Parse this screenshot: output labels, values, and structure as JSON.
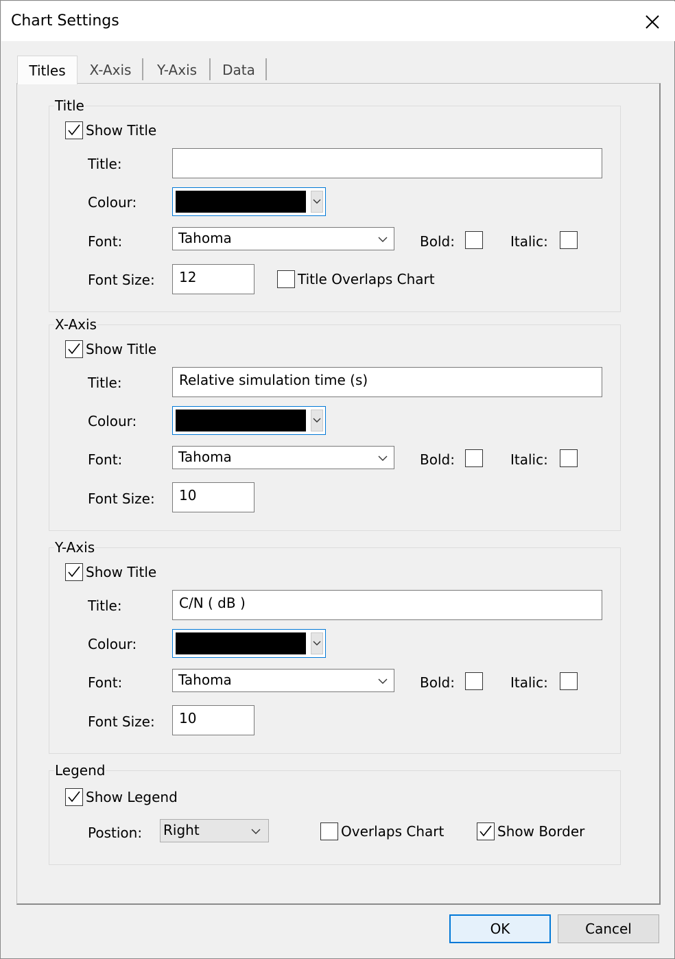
{
  "window": {
    "title": "Chart Settings"
  },
  "tabs": [
    "Titles",
    "X-Axis",
    "Y-Axis",
    "Data"
  ],
  "title_group": {
    "label": "Title",
    "show_title_label": "Show Title",
    "show_title_checked": true,
    "title_label": "Title:",
    "title_value": "",
    "colour_label": "Colour:",
    "colour_value": "#000000",
    "font_label": "Font:",
    "font_value": "Tahoma",
    "bold_label": "Bold:",
    "bold_checked": false,
    "italic_label": "Italic:",
    "italic_checked": false,
    "font_size_label": "Font Size:",
    "font_size_value": "12",
    "overlaps_label": "Title Overlaps Chart",
    "overlaps_checked": false
  },
  "xaxis_group": {
    "label": "X-Axis",
    "show_title_label": "Show Title",
    "show_title_checked": true,
    "title_label": "Title:",
    "title_value": "Relative simulation time (s)",
    "colour_label": "Colour:",
    "colour_value": "#000000",
    "font_label": "Font:",
    "font_value": "Tahoma",
    "bold_label": "Bold:",
    "bold_checked": false,
    "italic_label": "Italic:",
    "italic_checked": false,
    "font_size_label": "Font Size:",
    "font_size_value": "10"
  },
  "yaxis_group": {
    "label": "Y-Axis",
    "show_title_label": "Show Title",
    "show_title_checked": true,
    "title_label": "Title:",
    "title_value": "C/N ( dB )",
    "colour_label": "Colour:",
    "colour_value": "#000000",
    "font_label": "Font:",
    "font_value": "Tahoma",
    "bold_label": "Bold:",
    "bold_checked": false,
    "italic_label": "Italic:",
    "italic_checked": false,
    "font_size_label": "Font Size:",
    "font_size_value": "10"
  },
  "legend_group": {
    "label": "Legend",
    "show_legend_label": "Show Legend",
    "show_legend_checked": true,
    "position_label": "Postion:",
    "position_value": "Right",
    "overlaps_label": "Overlaps Chart",
    "overlaps_checked": false,
    "show_border_label": "Show Border",
    "show_border_checked": true
  },
  "buttons": {
    "ok": "OK",
    "cancel": "Cancel"
  },
  "icons": {
    "close": "close-icon",
    "check": "checkmark-icon",
    "dropdown": "chevron-down-icon"
  }
}
